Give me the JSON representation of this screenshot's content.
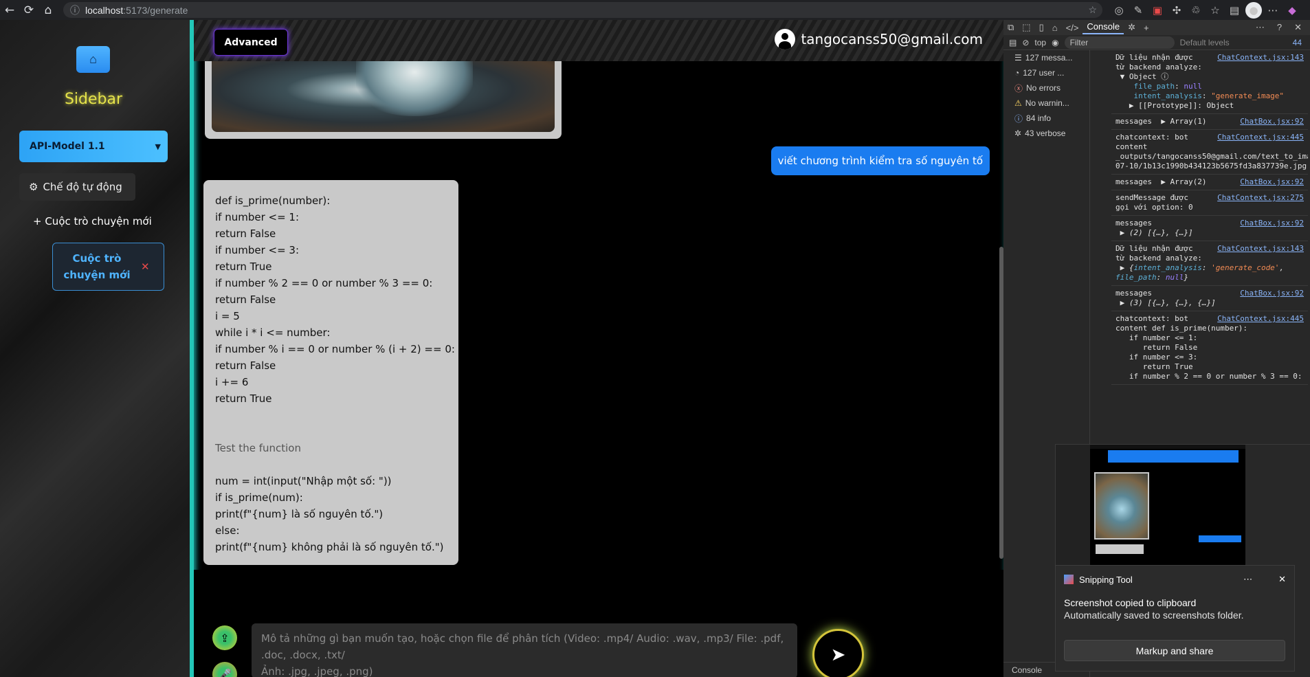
{
  "browser": {
    "url_host": "localhost",
    "url_path": ":5173/generate"
  },
  "sidebar": {
    "title": "Sidebar",
    "model_select": "API-Model 1.1",
    "auto_mode": "Chế độ tự động",
    "new_chat": "+ Cuộc trò chuyện mới",
    "chat_items": [
      {
        "label_line1": "Cuộc trò",
        "label_line2": "chuyện mới"
      }
    ]
  },
  "header": {
    "advanced": "Advanced",
    "email": "tangocanss50@gmail.com"
  },
  "chat": {
    "user_message": "viết chương trình kiểm tra số nguyên tố",
    "bot_code_lines": [
      "def is_prime(number):",
      "if number <= 1:",
      "return False",
      "if number <= 3:",
      "return True",
      "if number % 2 == 0 or number % 3 == 0:",
      "return False",
      "i = 5",
      "while i * i <= number:",
      "if number % i == 0 or number % (i + 2) == 0:",
      "return False",
      "i += 6",
      "return True",
      "",
      "",
      "Test the function",
      "",
      "num = int(input(\"Nhập một số: \"))",
      "if is_prime(num):",
      "print(f\"{num} là số nguyên tố.\")",
      "else:",
      "print(f\"{num} không phải là số nguyên tố.\")"
    ]
  },
  "composer": {
    "placeholder_line1": "Mô tả những gì bạn muốn tạo, hoặc chọn file để phân tích (Video: .mp4/ Audio: .wav, .mp3/ File: .pdf, .doc, .docx, .txt/",
    "placeholder_line2": "Ảnh: .jpg, .jpeg, .png)"
  },
  "devtools": {
    "tabs": [
      "Console"
    ],
    "context": "top",
    "filter_placeholder": "Filter",
    "levels": "Default levels",
    "issue_count": "44",
    "sidebar_items": [
      {
        "icon": "list-icon",
        "label": "127 messa..."
      },
      {
        "icon": "user-icon",
        "label": "127 user ..."
      },
      {
        "icon": "error-icon",
        "label": "No errors"
      },
      {
        "icon": "warning-icon",
        "label": "No warnin..."
      },
      {
        "icon": "info-icon",
        "label": "84 info"
      },
      {
        "icon": "bug-icon",
        "label": "43 verbose"
      }
    ],
    "bottom_tab": "Console"
  },
  "snipping": {
    "title": "Snipping Tool",
    "line1": "Screenshot copied to clipboard",
    "line2": "Automatically saved to screenshots folder.",
    "button": "Markup and share"
  },
  "colors": {
    "accent_blue": "#1a7cf0",
    "sidebar_title": "#e5e34a",
    "main_border": "#23c7b8"
  }
}
